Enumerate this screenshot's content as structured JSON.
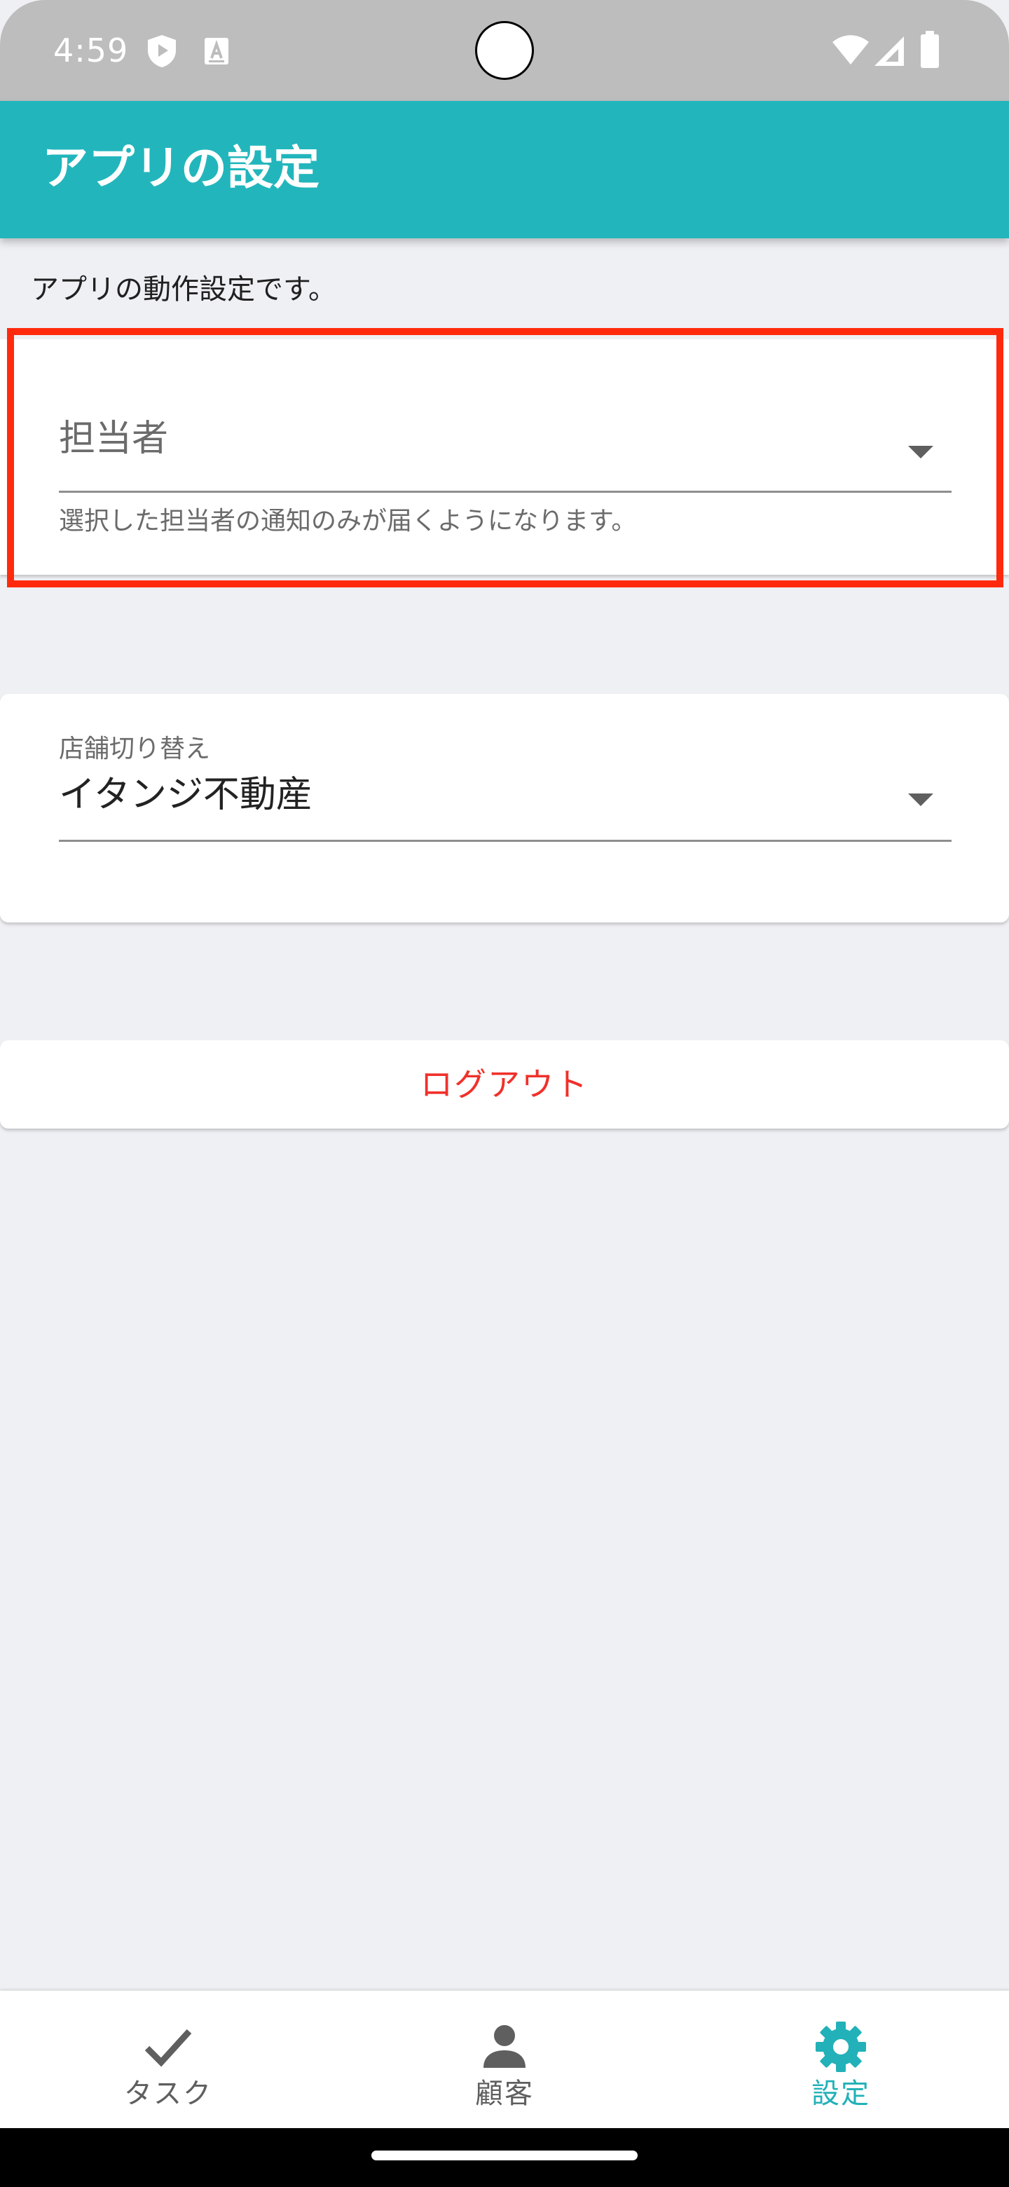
{
  "status_bar": {
    "time": "4:59",
    "icons": [
      "shield-play-icon",
      "a-notification-icon",
      "wifi-icon",
      "signal-icon",
      "battery-icon"
    ]
  },
  "app_bar": {
    "title": "アプリの設定",
    "color": "#22b6bc"
  },
  "main": {
    "description": "アプリの動作設定です。",
    "assignee_select": {
      "label": "担当者",
      "value": "",
      "helper": "選択した担当者の通知のみが届くようになります。"
    },
    "store_select": {
      "label": "店舗切り替え",
      "value": "イタンジ不動産"
    },
    "logout_button": {
      "label": "ログアウト",
      "color": "#f0302a"
    },
    "highlight_color": "#ff2a0d"
  },
  "bottom_nav": {
    "items": [
      {
        "label": "タスク",
        "icon": "check-icon",
        "active": false
      },
      {
        "label": "顧客",
        "icon": "person-icon",
        "active": false
      },
      {
        "label": "設定",
        "icon": "gear-icon",
        "active": true
      }
    ],
    "active_color": "#22b1b8"
  }
}
